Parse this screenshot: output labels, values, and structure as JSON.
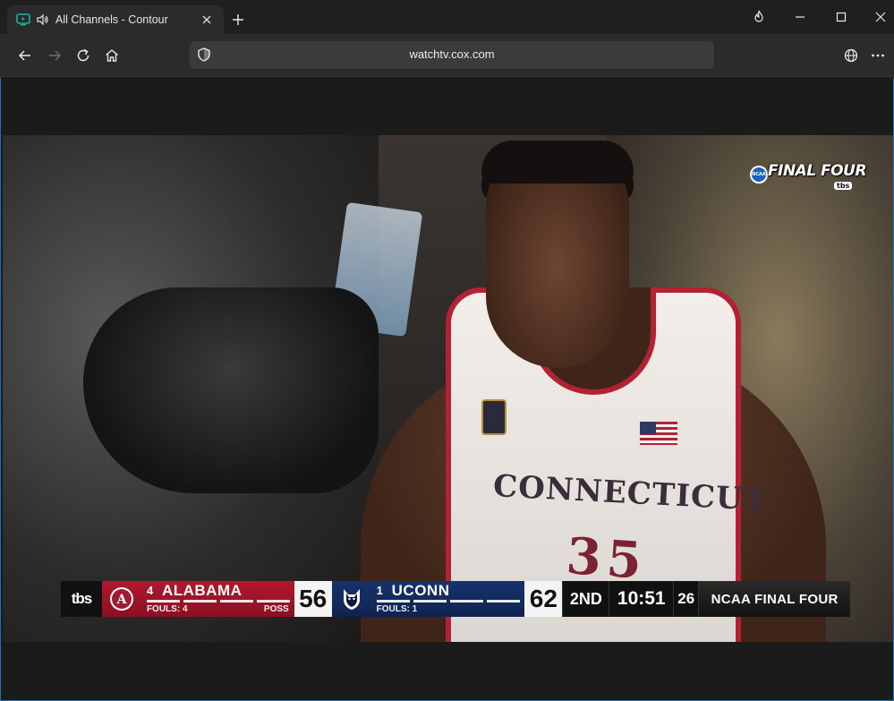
{
  "browser": {
    "tab": {
      "title": "All Channels - Contour",
      "favicon": "tv-icon",
      "audio_icon": "speaker-icon",
      "close_icon": "close-icon"
    },
    "new_tab_icon": "plus-icon",
    "window_controls": [
      "flame-icon",
      "minimize-icon",
      "maximize-icon",
      "close-icon"
    ],
    "toolbar": {
      "back_icon": "back-arrow-icon",
      "forward_icon": "forward-arrow-icon",
      "reload_icon": "reload-icon",
      "home_icon": "home-icon",
      "address": "watchtv.cox.com",
      "shield_icon": "shield-icon",
      "globe_icon": "globe-icon",
      "menu_icon": "more-icon"
    },
    "accent_color": "#2b6cb0"
  },
  "video": {
    "bug": {
      "text": "FINAL FOUR",
      "badge": "NCAA",
      "network": "tbs"
    },
    "jersey": {
      "name": "CONNECTICUT",
      "number": "35"
    },
    "scoreboard": {
      "network": "tbs",
      "away": {
        "rank": "4",
        "name": "ALABAMA",
        "fouls": "FOULS: 4",
        "possession": "POSS",
        "score": "56",
        "color": "#b3172e"
      },
      "home": {
        "rank": "1",
        "name": "UCONN",
        "fouls": "FOULS: 1",
        "score": "62",
        "color": "#17336b"
      },
      "period": "2ND",
      "clock": "10:51",
      "shot_clock": "26",
      "event": "NCAA FINAL FOUR"
    }
  }
}
